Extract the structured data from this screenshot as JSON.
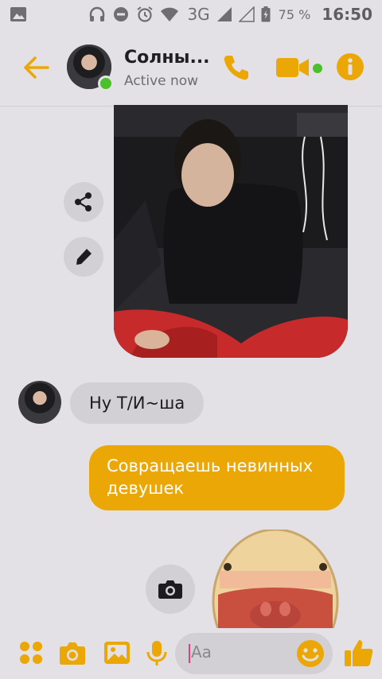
{
  "status_bar": {
    "network": "3G",
    "battery": "75 %",
    "time": "16:50"
  },
  "header": {
    "contact_name": "Солны...",
    "contact_status": "Active now"
  },
  "messages": {
    "incoming_text": "Ну Т/И~ша",
    "outgoing_text": "Совращаешь невинных девушек"
  },
  "composer": {
    "placeholder": "Aa"
  },
  "colors": {
    "accent": "#eba706",
    "online": "#4cc02a",
    "background": "#e3e1e6",
    "incoming_bubble": "#d2d0d5"
  },
  "icons": [
    "gallery-icon",
    "headphones-icon",
    "dnd-icon",
    "alarm-icon",
    "wifi-icon",
    "signal-icon",
    "battery-icon",
    "back-arrow-icon",
    "phone-icon",
    "video-icon",
    "info-icon",
    "share-icon",
    "pencil-icon",
    "camera-icon",
    "apps-icon",
    "image-icon",
    "microphone-icon",
    "emoji-icon",
    "thumbs-up-icon"
  ]
}
